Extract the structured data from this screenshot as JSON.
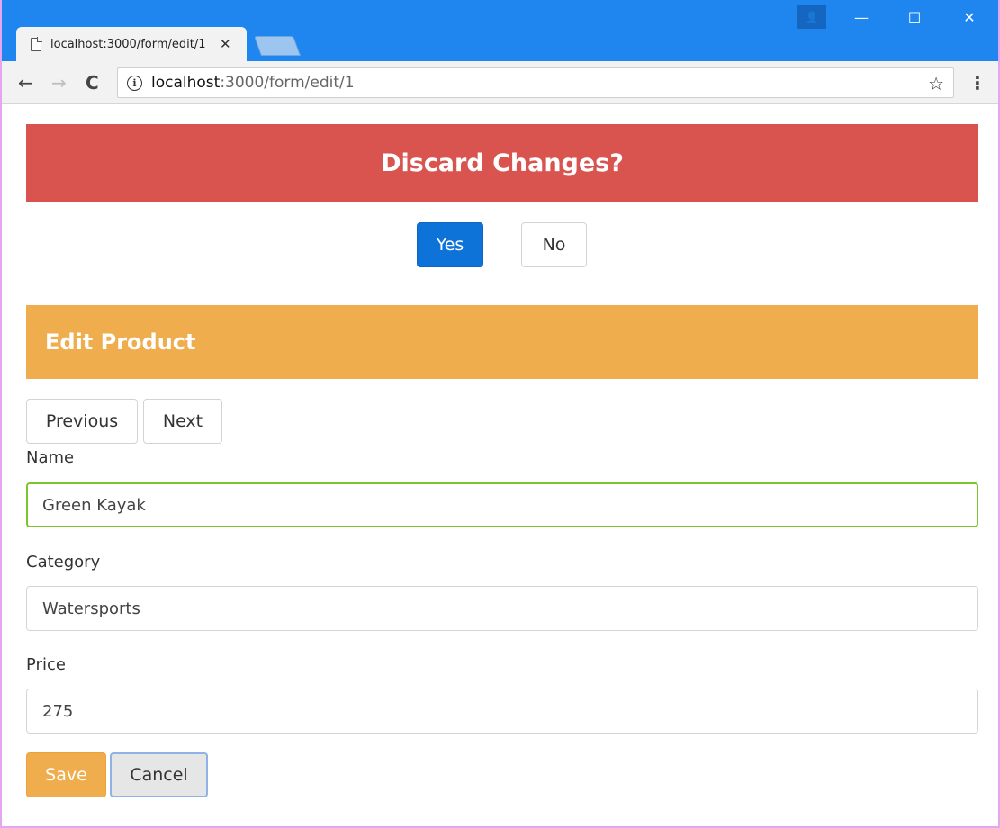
{
  "browser": {
    "tab_title": "localhost:3000/form/edit/1",
    "tab_close": "✕",
    "url_host": "localhost",
    "url_path": ":3000/form/edit/1",
    "window_controls": {
      "profile": "👤",
      "minimize": "—",
      "maximize": "☐",
      "close": "✕"
    },
    "nav": {
      "back": "←",
      "forward": "→",
      "reload": "C",
      "info": "i",
      "star": "☆",
      "menu": "⋮"
    }
  },
  "dialog": {
    "title": "Discard Changes?",
    "yes_label": "Yes",
    "no_label": "No"
  },
  "editor": {
    "title": "Edit Product",
    "previous_label": "Previous",
    "next_label": "Next",
    "fields": {
      "name_label": "Name",
      "name_value": "Green Kayak",
      "category_label": "Category",
      "category_value": "Watersports",
      "price_label": "Price",
      "price_value": "275"
    },
    "save_label": "Save",
    "cancel_label": "Cancel"
  },
  "colors": {
    "danger": "#d9534f",
    "warning": "#f0ad4e",
    "primary": "#0e73d8",
    "valid_border": "#7bc62d",
    "titlebar": "#1f86f0"
  }
}
